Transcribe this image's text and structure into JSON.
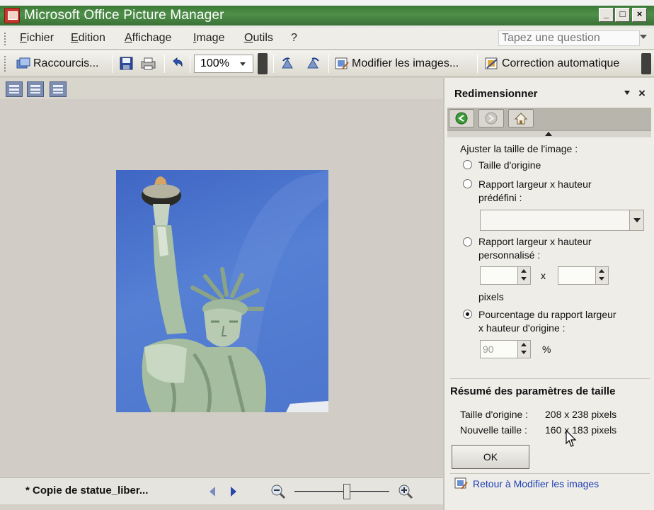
{
  "window": {
    "title": "Microsoft Office Picture Manager",
    "minimize_label": "_",
    "maximize_label": "□",
    "close_label": "×"
  },
  "menu": {
    "items": [
      "Fichier",
      "Edition",
      "Affichage",
      "Image",
      "Outils",
      "?"
    ],
    "ask_placeholder": "Tapez une question"
  },
  "toolbar": {
    "shortcuts_label": "Raccourcis...",
    "zoom_value": "100%",
    "edit_pictures_label": "Modifier les images...",
    "auto_correct_label": "Correction automatique"
  },
  "status": {
    "file_name": "* Copie de statue_liber...",
    "zoom_level": 0.55
  },
  "taskpane": {
    "title": "Redimensionner",
    "close_label": "×",
    "adjust_label": "Ajuster la taille de l'image :",
    "options": {
      "original": "Taille d'origine",
      "predefined_line1": "Rapport largeur x hauteur",
      "predefined_line2": "prédéfini :",
      "custom_line1": "Rapport largeur x hauteur",
      "custom_line2": "personnalisé :",
      "percent_line1": "Pourcentage du rapport largeur",
      "percent_line2": "x hauteur d'origine :"
    },
    "selected_option": "percent",
    "times_label": "x",
    "pixels_label": "pixels",
    "percent_value": "90",
    "percent_unit": "%",
    "summary_title": "Résumé des paramètres de taille",
    "original_size_label": "Taille d'origine :",
    "original_size_value": "208 x 238 pixels",
    "new_size_label": "Nouvelle taille :",
    "new_size_value": "160 x 183 pixels",
    "ok_label": "OK",
    "back_link": "Retour à Modifier les images"
  },
  "colors": {
    "titlebar": "#3a7a36",
    "link": "#1f3fb4",
    "sky": "#4d76cc",
    "statue": "#9fb79c"
  }
}
